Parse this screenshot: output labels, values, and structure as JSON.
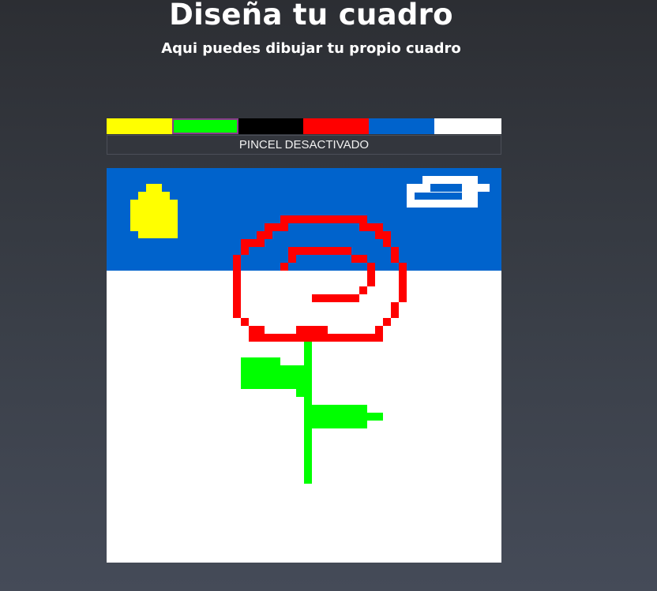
{
  "header": {
    "title": "Diseña tu cuadro",
    "subtitle": "Aqui puedes dibujar tu propio cuadro"
  },
  "palette": {
    "swatches": [
      {
        "name": "yellow",
        "color": "#ffff00"
      },
      {
        "name": "green",
        "color": "#00ff00"
      },
      {
        "name": "black",
        "color": "#000000"
      },
      {
        "name": "red",
        "color": "#ff0000"
      },
      {
        "name": "blue",
        "color": "#0063cc"
      },
      {
        "name": "white",
        "color": "#ffffff"
      }
    ],
    "selected": "green",
    "brush_status": "PINCEL DESACTIVADO"
  },
  "canvas": {
    "grid": "50x50",
    "background": "#ffffff",
    "artwork": "pixel-art rose with green stem and leaves, yellow sun and white cloud on blue sky"
  }
}
